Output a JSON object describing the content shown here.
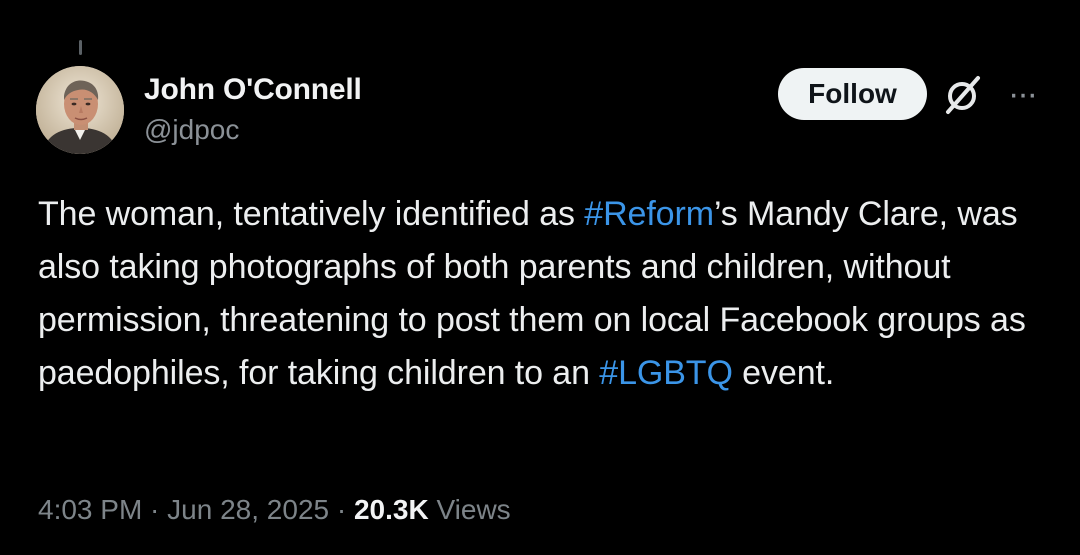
{
  "author": {
    "display_name": "John O'Connell",
    "handle": "@jdpoc",
    "avatar_description": "avatar"
  },
  "actions": {
    "follow_label": "Follow",
    "grok_icon": "grok-icon",
    "more_icon": "more-options-icon",
    "more_glyph": "···"
  },
  "tweet": {
    "segments": [
      {
        "text": "The woman, tentatively identified as ",
        "type": "text"
      },
      {
        "text": "#Reform",
        "type": "hashtag"
      },
      {
        "text": "’s Mandy Clare, was also taking photographs of both parents and children, without permission, threatening to post them on local Facebook groups as paedophiles, for taking children to an ",
        "type": "text"
      },
      {
        "text": "#LGBTQ",
        "type": "hashtag"
      },
      {
        "text": " event.",
        "type": "text"
      }
    ]
  },
  "meta": {
    "time": "4:03 PM",
    "separator_1": " · ",
    "date": "Jun 28, 2025",
    "separator_2": " · ",
    "views_count": "20.3K",
    "views_label": " Views"
  },
  "colors": {
    "background": "#000000",
    "text": "#eceeef",
    "muted": "#7d8489",
    "link": "#3b95e8",
    "follow_bg": "#eff3f4"
  }
}
